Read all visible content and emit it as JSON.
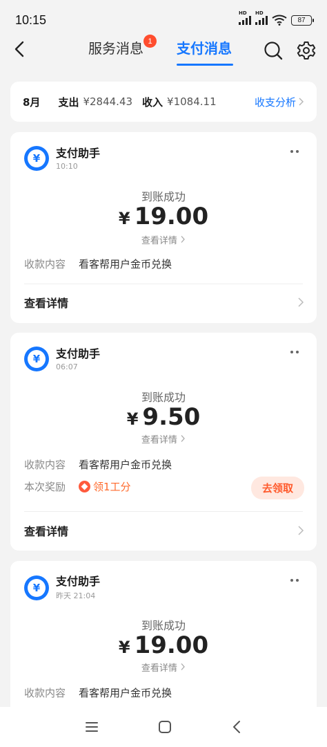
{
  "status_bar": {
    "time": "10:15",
    "battery": "87",
    "hd": "HD"
  },
  "nav": {
    "tabs": [
      {
        "label": "服务消息",
        "badge": "1"
      },
      {
        "label": "支付消息"
      }
    ]
  },
  "summary": {
    "month": "8月",
    "expense_label": "支出",
    "expense_value": "¥2844.43",
    "income_label": "收入",
    "income_value": "¥1084.11",
    "analysis_link": "收支分析"
  },
  "messages": [
    {
      "sender": "支付助手",
      "time": "10:10",
      "status": "到账成功",
      "currency": "¥",
      "amount": "19.00",
      "view_detail_small": "查看详情",
      "rows": [
        {
          "key": "收款内容",
          "value": "看客帮用户金币兑换"
        }
      ],
      "footer": "查看详情"
    },
    {
      "sender": "支付助手",
      "time": "06:07",
      "status": "到账成功",
      "currency": "¥",
      "amount": "9.50",
      "view_detail_small": "查看详情",
      "rows": [
        {
          "key": "收款内容",
          "value": "看客帮用户金币兑换"
        }
      ],
      "reward": {
        "key": "本次奖励",
        "value": "领1工分",
        "button": "去领取"
      },
      "footer": "查看详情"
    },
    {
      "sender": "支付助手",
      "time": "昨天 21:04",
      "status": "到账成功",
      "currency": "¥",
      "amount": "19.00",
      "view_detail_small": "查看详情",
      "rows": [
        {
          "key": "收款内容",
          "value": "看客帮用户金币兑换"
        }
      ]
    }
  ],
  "colors": {
    "accent": "#1677ff",
    "badge": "#ff4d2e",
    "reward": "#ff5a2c",
    "background": "#f3f3f3"
  },
  "icons": [
    "back-arrow-icon",
    "search-icon",
    "gear-icon",
    "yuan-icon",
    "more-dots-icon",
    "chevron-right-icon",
    "menu-icon",
    "home-square-icon",
    "back-triangle-icon"
  ]
}
